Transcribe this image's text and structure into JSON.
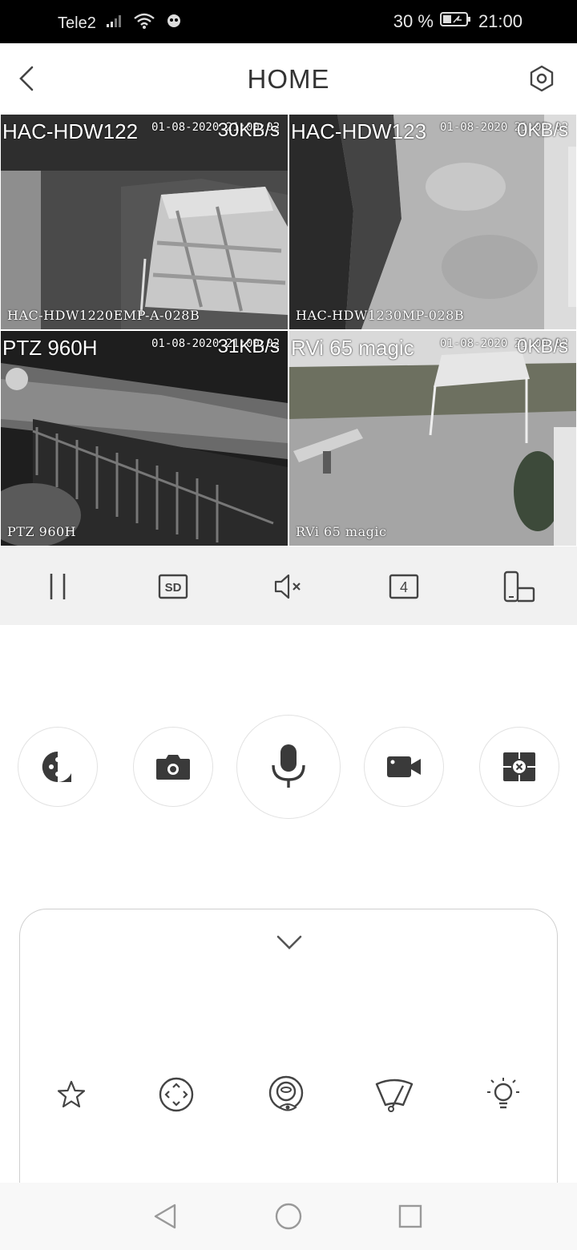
{
  "status_bar": {
    "carrier": "Tele2",
    "battery_percent": "30 %",
    "time": "21:00",
    "icons": [
      "signal-icon",
      "wifi-icon",
      "notification-icon",
      "battery-icon"
    ]
  },
  "header": {
    "title": "HOME",
    "back_icon": "chevron-left-icon",
    "settings_icon": "settings-hex-icon"
  },
  "cameras": [
    {
      "title": "HAC-HDW122",
      "timestamp": "01-08-2020 21:00:02",
      "rate": "30KB/s",
      "osd_label": "HAC-HDW1220EMP-A-028B",
      "selected": true
    },
    {
      "title": "HAC-HDW123",
      "timestamp": "01-08-2020 21:00:02",
      "rate": "0KB/s",
      "osd_label": "HAC-HDW1230MP-028B",
      "selected": false
    },
    {
      "title": "PTZ 960H",
      "timestamp": "01-08-2020 21:00:02",
      "rate": "31KB/s",
      "osd_label": "PTZ 960H",
      "selected": false
    },
    {
      "title": "RVi 65 magic",
      "timestamp": "01-08-2020 21:00:02",
      "rate": "0KB/s",
      "osd_label": "RVi 65 magic",
      "selected": false
    }
  ],
  "control_bar": {
    "buttons": [
      "pause-icon",
      "sd-quality-icon",
      "mute-icon",
      "split-count-icon",
      "fullscreen-rotate-icon"
    ],
    "sd_label": "SD",
    "split_count": "4"
  },
  "actions": [
    "ptz-icon",
    "snapshot-icon",
    "talk-mic-icon",
    "record-icon",
    "close-all-icon"
  ],
  "ptz_panel": {
    "collapse_icon": "chevron-down-icon",
    "buttons": [
      "favorite-star-icon",
      "direction-icon",
      "fisheye-icon",
      "wiper-icon",
      "light-icon"
    ]
  },
  "nav_bar": [
    "back-triangle-icon",
    "home-circle-icon",
    "recents-square-icon"
  ],
  "colors": {
    "accent": "#2a6fd6",
    "icon": "#444444",
    "control_bg": "#f1f1f1"
  }
}
